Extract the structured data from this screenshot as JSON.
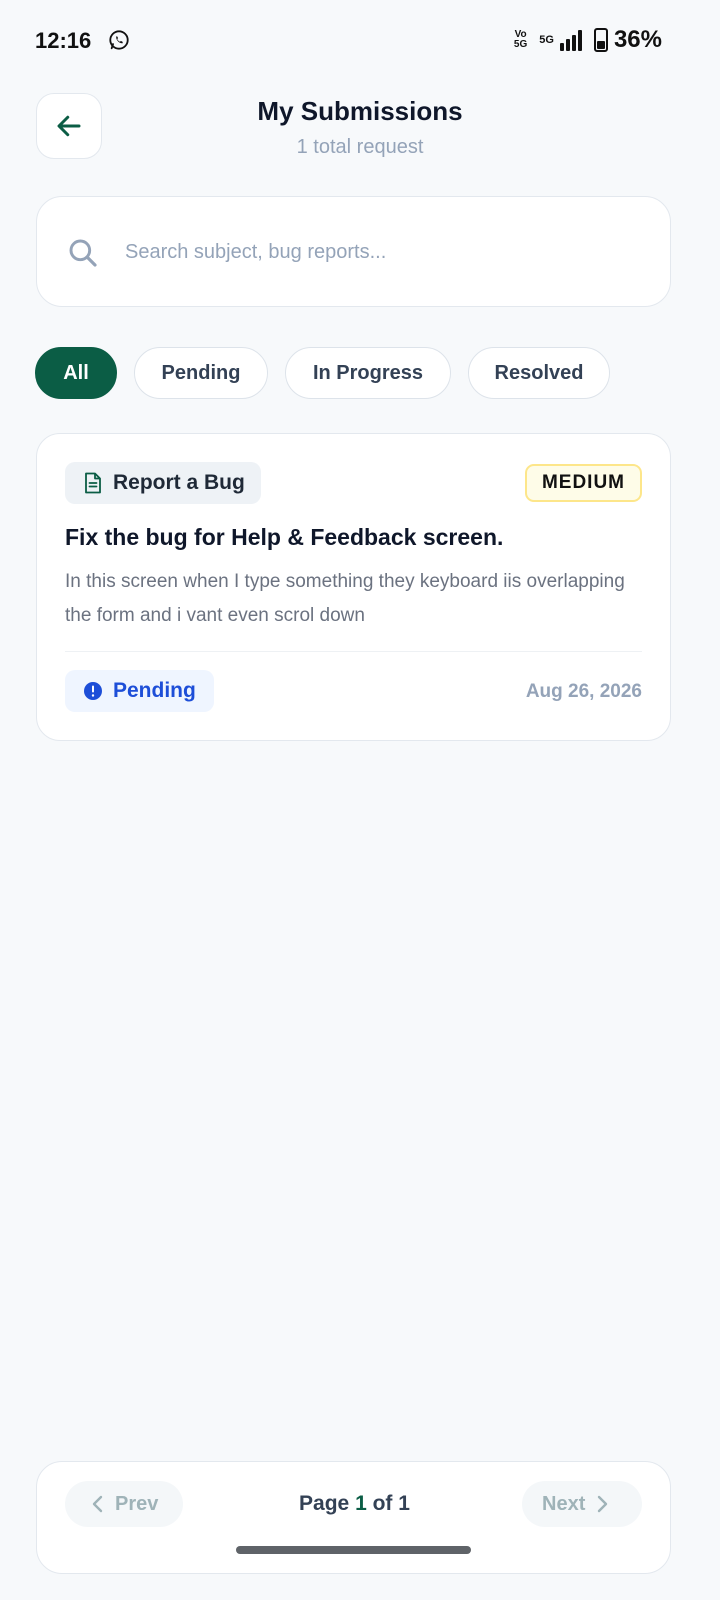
{
  "status_bar": {
    "time": "12:16",
    "volte_top": "Vo",
    "volte_bottom": "5G",
    "network": "5G",
    "battery": "36%"
  },
  "header": {
    "title": "My Submissions",
    "subtitle": "1 total request"
  },
  "search": {
    "placeholder": "Search subject, bug reports...",
    "value": ""
  },
  "filters": [
    {
      "label": "All",
      "active": true
    },
    {
      "label": "Pending",
      "active": false
    },
    {
      "label": "In Progress",
      "active": false
    },
    {
      "label": "Resolved",
      "active": false
    }
  ],
  "submissions": [
    {
      "category": "Report a Bug",
      "priority": "MEDIUM",
      "title": "Fix the bug for Help & Feedback screen.",
      "description": "In this screen when I type something they keyboard iis overlapping the form and i vant even scrol down",
      "status": "Pending",
      "date": "Aug 26, 2026"
    }
  ],
  "pagination": {
    "prev_label": "Prev",
    "next_label": "Next",
    "page_word": "Page",
    "current": "1",
    "of_word": "of",
    "total": "1"
  },
  "colors": {
    "accent": "#0b5d45",
    "background": "#f7f9fb",
    "status_pending": "#1d4ed8",
    "priority_medium_bg": "#fefce8"
  },
  "icons": {
    "back": "arrow-left-icon",
    "search": "search-icon",
    "category": "document-icon",
    "status": "info-circle-icon",
    "prev": "chevron-left-icon",
    "next": "chevron-right-icon"
  }
}
